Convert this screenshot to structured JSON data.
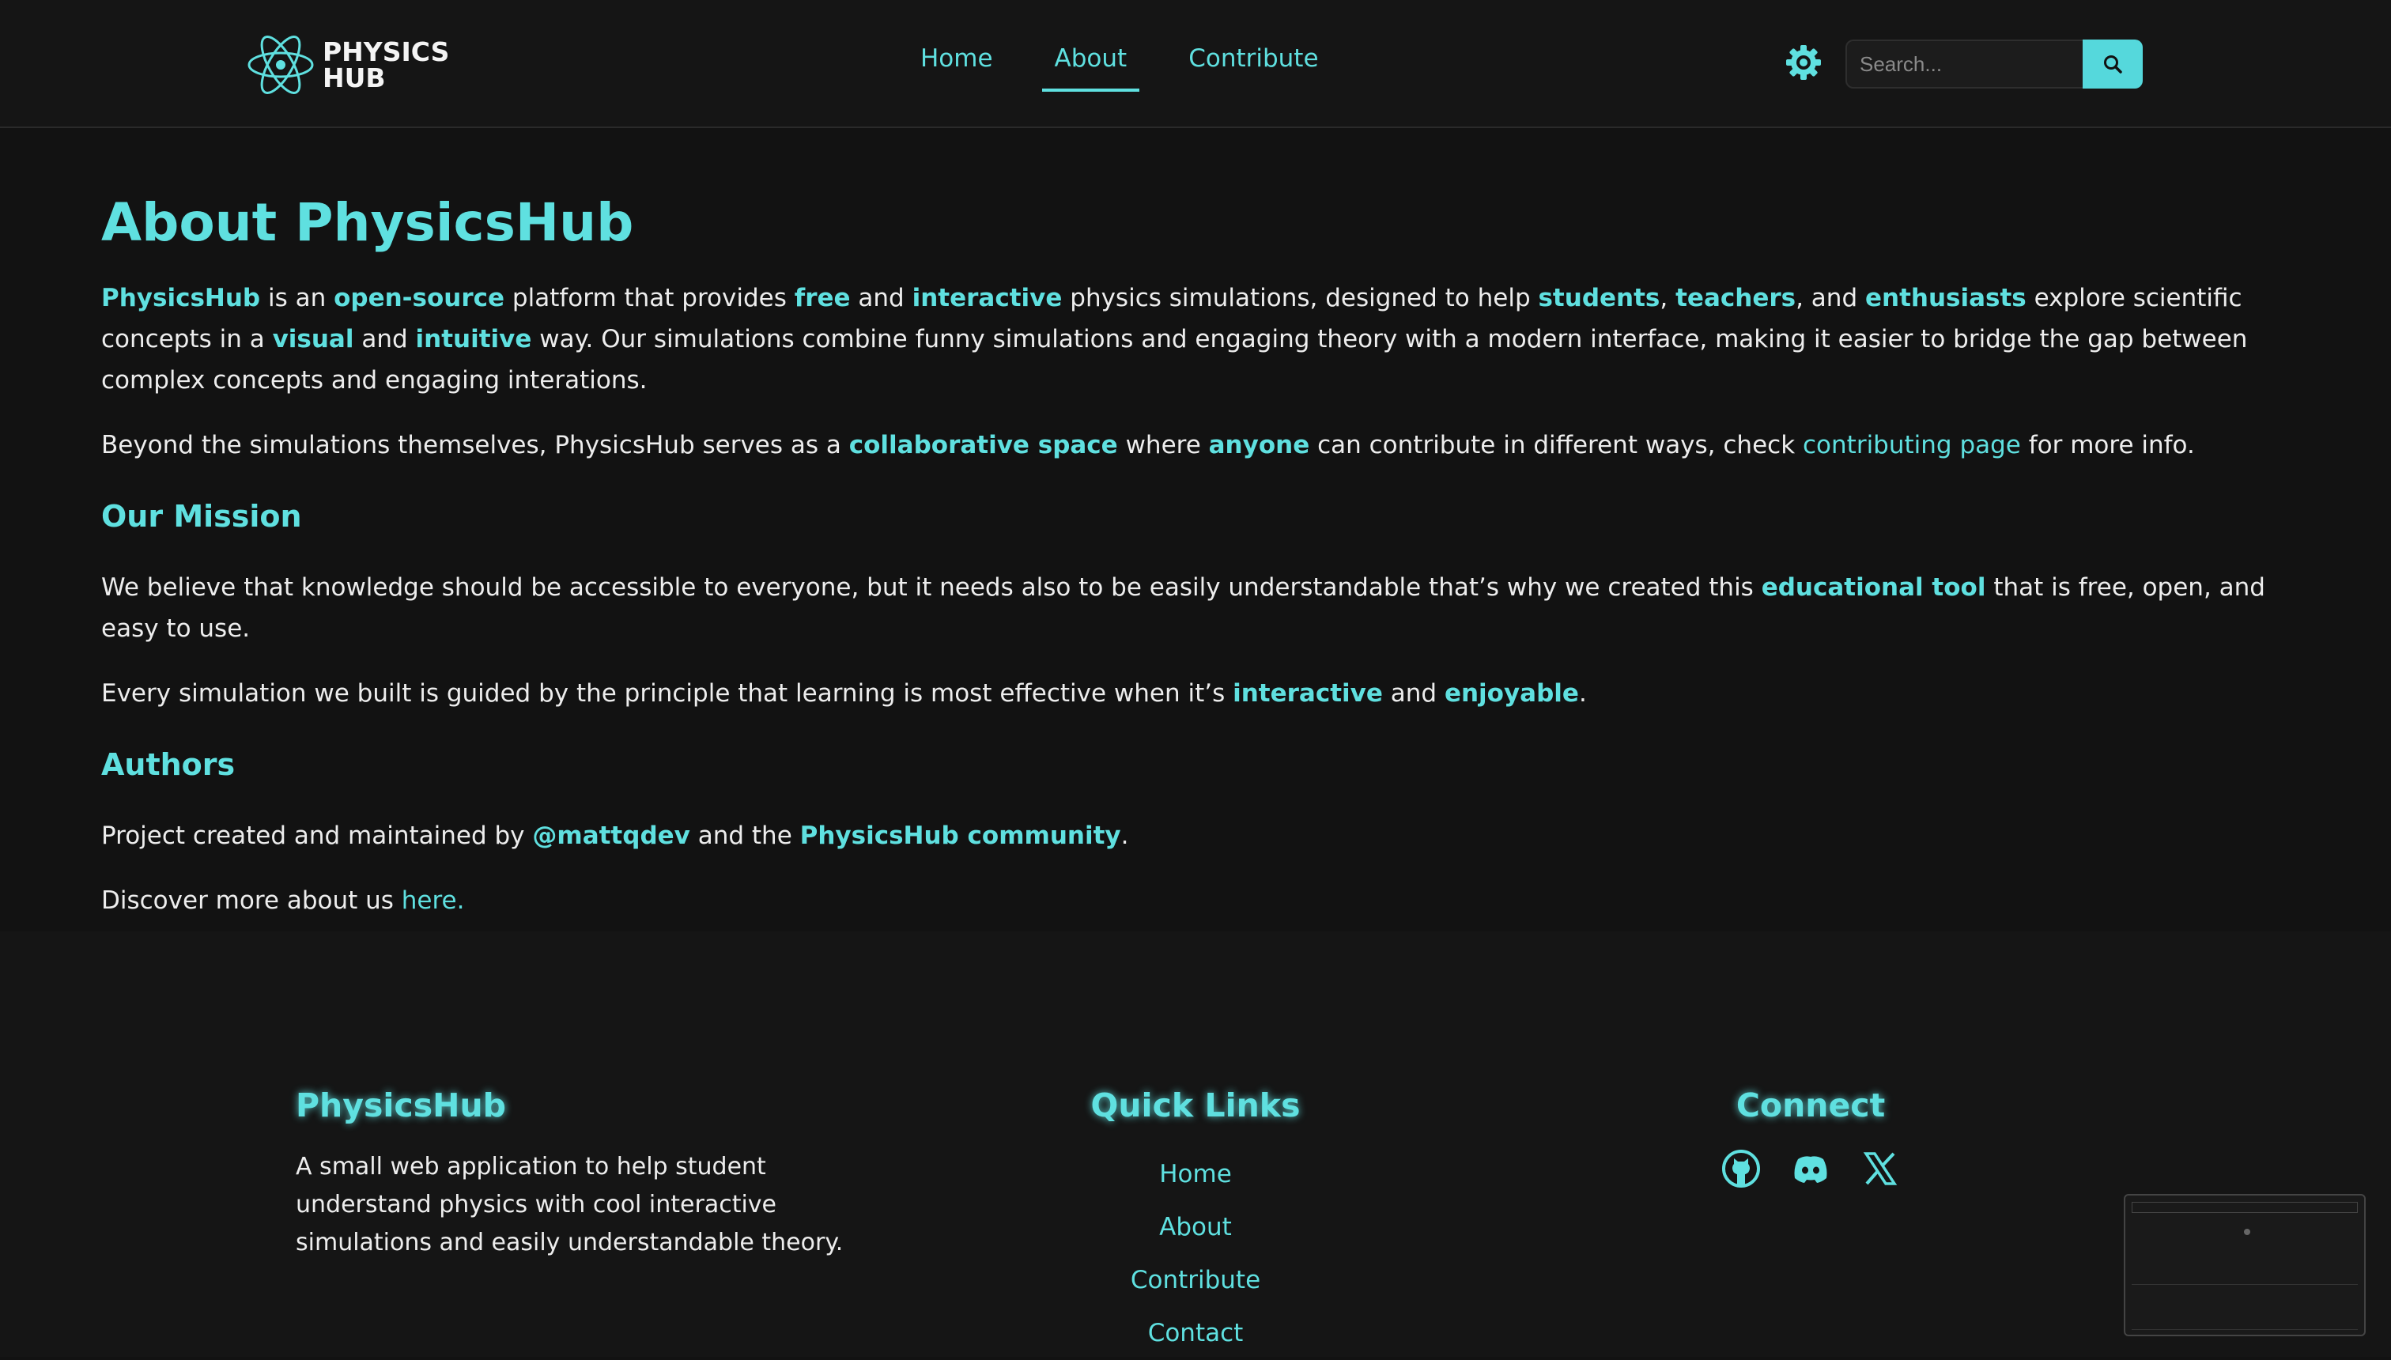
{
  "header": {
    "logo_line1": "PHYSICS",
    "logo_line2": "HUB",
    "nav": [
      {
        "label": "Home"
      },
      {
        "label": "About"
      },
      {
        "label": "Contribute"
      }
    ],
    "search_placeholder": "Search...",
    "accent": "#5fe0e0"
  },
  "main": {
    "title": "About PhysicsHub",
    "p1": {
      "s1": "PhysicsHub",
      "t1": " is an ",
      "s2": "open-source",
      "t2": " platform that provides ",
      "s3": "free",
      "t3": " and ",
      "s4": "interactive",
      "t4": " physics simulations, designed to help ",
      "s5": "students",
      "t5": ", ",
      "s6": "teachers",
      "t6": ", and ",
      "s7": "enthusiasts",
      "t7": " explore scientific concepts in a ",
      "s8": "visual",
      "t8": " and ",
      "s9": "intuitive",
      "t9": " way. Our simulations combine funny simulations and engaging theory with a modern interface, making it easier to bridge the gap between complex concepts and engaging interations."
    },
    "p2": {
      "t1": "Beyond the simulations themselves, PhysicsHub serves as a ",
      "s1": "collaborative space",
      "t2": " where ",
      "s2": "anyone",
      "t3": " can contribute in different ways, check ",
      "link": "contributing page",
      "t4": " for more info."
    },
    "mission_heading": "Our Mission",
    "p3": {
      "t1": "We believe that knowledge should be accessible to everyone, but it needs also to be easily understandable that’s why we created this ",
      "s1": "educational tool",
      "t2": " that is free, open, and easy to use."
    },
    "p4": {
      "t1": "Every simulation we built is guided by the principle that learning is most effective when it’s ",
      "s1": "interactive",
      "t2": " and ",
      "s2": "enjoyable",
      "t3": "."
    },
    "authors_heading": "Authors",
    "p5": {
      "t1": "Project created and maintained by ",
      "s1": "@mattqdev",
      "t2": " and the ",
      "s2": "PhysicsHub community",
      "t3": "."
    },
    "p6": {
      "t1": "Discover more about us ",
      "link": "here."
    }
  },
  "footer": {
    "brand_title": "PhysicsHub",
    "brand_desc": "A small web application to help student understand physics with cool interactive simulations and easily understandable theory.",
    "links_title": "Quick Links",
    "links": [
      {
        "label": "Home"
      },
      {
        "label": "About"
      },
      {
        "label": "Contribute"
      },
      {
        "label": "Contact"
      }
    ],
    "connect_title": "Connect",
    "social": [
      {
        "icon": "github-icon"
      },
      {
        "icon": "discord-icon"
      },
      {
        "icon": "x-icon"
      }
    ]
  }
}
